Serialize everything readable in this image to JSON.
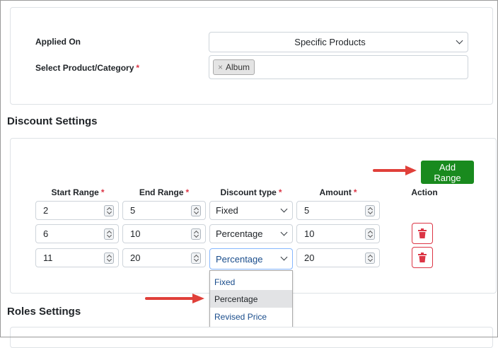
{
  "product_card": {
    "applied_on_label": "Applied On",
    "applied_on_value": "Specific Products",
    "select_label": "Select Product/Category",
    "required_mark": "*",
    "tags": [
      {
        "remove": "×",
        "label": "Album"
      }
    ]
  },
  "discount": {
    "heading": "Discount Settings",
    "add_range_label": "Add Range",
    "columns": {
      "start": "Start Range",
      "end": "End Range",
      "type": "Discount type",
      "amount": "Amount",
      "action": "Action"
    },
    "rows": [
      {
        "start": "2",
        "end": "5",
        "type": "Fixed",
        "amount": "5"
      },
      {
        "start": "6",
        "end": "10",
        "type": "Percentage",
        "amount": "10"
      },
      {
        "start": "11",
        "end": "20",
        "type": "Percentage",
        "amount": "20"
      }
    ],
    "dropdown_options": [
      "Fixed",
      "Percentage",
      "Revised Price"
    ],
    "dropdown_selected": "Percentage"
  },
  "roles": {
    "heading": "Roles Settings"
  },
  "colors": {
    "add_button": "#198a1e",
    "delete": "#dc3545",
    "arrow": "#e0403a"
  },
  "icons": {
    "delete": "trash-icon",
    "arrow": "pointer-arrow-icon"
  }
}
